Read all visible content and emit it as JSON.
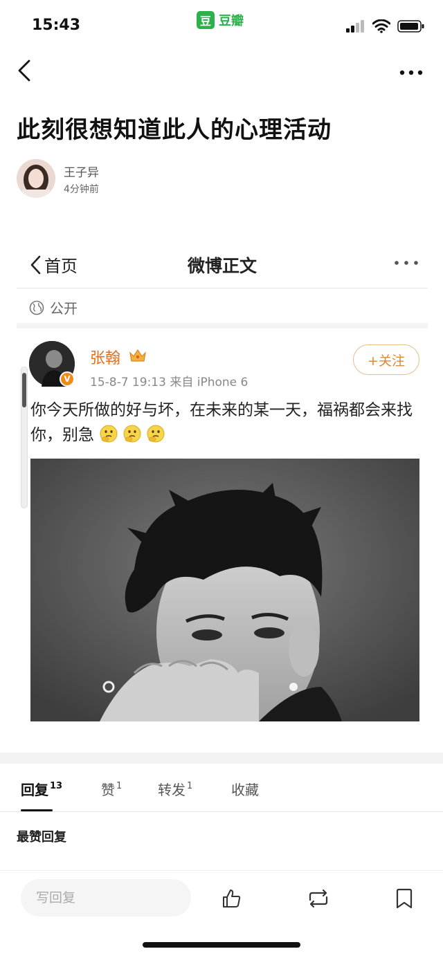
{
  "status_bar": {
    "time": "15:43",
    "app_badge": "豆",
    "app_name": "豆瓣",
    "icons": [
      "signal-icon",
      "wifi-icon",
      "battery-icon"
    ]
  },
  "nav": {
    "back_icon": "chevron-left-icon",
    "more_icon": "more-dots-icon"
  },
  "post": {
    "title": "此刻很想知道此人的心理活动",
    "author": "王子异",
    "time": "4分钟前"
  },
  "weibo": {
    "back_label": "首页",
    "header_title": "微博正文",
    "visibility": "公开",
    "user_name": "张翰",
    "verified_badge": "V",
    "meta": "15-8-7 19:13  来自 iPhone 6",
    "follow_label": "+关注",
    "content": "你今天所做的好与坏，在未来的某一天，福祸都会来找你，别急",
    "emoji_count": 3,
    "accent_color": "#e86d1b"
  },
  "tabs": [
    {
      "label": "回复",
      "count": "13"
    },
    {
      "label": "赞",
      "count": "1"
    },
    {
      "label": "转发",
      "count": "1"
    },
    {
      "label": "收藏",
      "count": ""
    }
  ],
  "comments": {
    "section_title": "最赞回复"
  },
  "bottom_bar": {
    "reply_placeholder": "写回复",
    "icons": [
      "like-icon",
      "repost-icon",
      "bookmark-icon"
    ]
  },
  "colors": {
    "douban_green": "#2bb24c",
    "follow_border": "#e0c083"
  }
}
